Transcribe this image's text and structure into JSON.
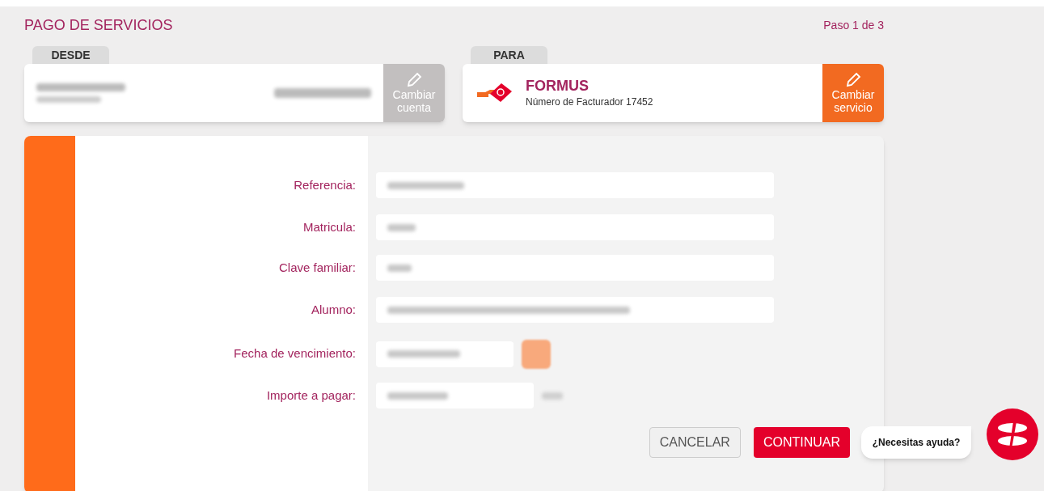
{
  "header": {
    "title": "PAGO DE SERVICIOS",
    "step": "Paso 1 de 3"
  },
  "from": {
    "tab": "DESDE",
    "change_button": [
      "Cambiar",
      "cuenta"
    ]
  },
  "to": {
    "tab": "PARA",
    "name": "FORMUS",
    "biller": "Número de Facturador 17452",
    "change_button": [
      "Cambiar",
      "servicio"
    ]
  },
  "form": {
    "fields": [
      {
        "label": "Referencia:",
        "kind": "text"
      },
      {
        "label": "Matricula:",
        "kind": "text"
      },
      {
        "label": "Clave familiar:",
        "kind": "text"
      },
      {
        "label": "Alumno:",
        "kind": "text"
      },
      {
        "label": "Fecha de vencimiento:",
        "kind": "date"
      },
      {
        "label": "Importe a pagar:",
        "kind": "amount"
      }
    ]
  },
  "buttons": [
    {
      "label": "CANCELAR",
      "kind": "secondary"
    },
    {
      "label": "CONTINUAR",
      "kind": "primary"
    }
  ],
  "help": {
    "label": "¿Necesitas ayuda?"
  }
}
